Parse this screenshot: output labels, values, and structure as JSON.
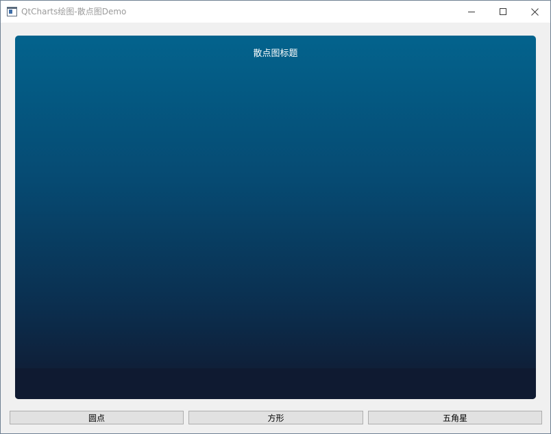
{
  "window": {
    "title": "QtCharts绘图-散点图Demo"
  },
  "chart_data": {
    "type": "scatter",
    "title": "散点图标题",
    "series": []
  },
  "buttons": {
    "circle": "圆点",
    "square": "方形",
    "star": "五角星"
  },
  "colors": {
    "chart_top": "#03638d",
    "chart_bottom": "#0f1a30",
    "button_bg": "#e1e1e1"
  }
}
